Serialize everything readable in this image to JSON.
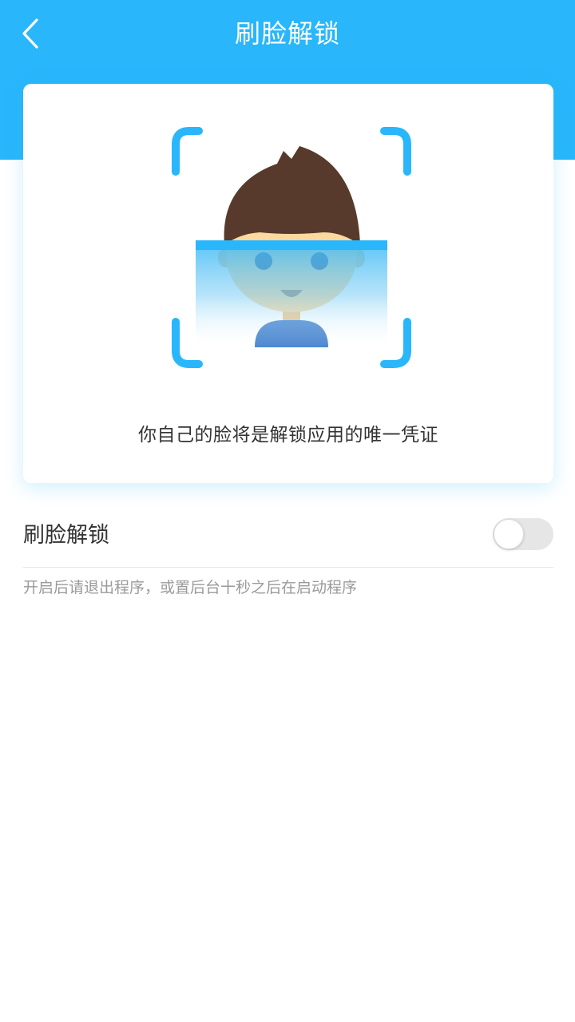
{
  "header": {
    "title": "刷脸解锁",
    "back_icon": "chevron-left-icon",
    "background_color": "#29b6fb"
  },
  "card": {
    "illustration": "face-scan-illustration",
    "caption": "你自己的脸将是解锁应用的唯一凭证"
  },
  "setting": {
    "label": "刷脸解锁",
    "enabled": false,
    "hint": "开启后请退出程序，或置后台十秒之后在启动程序"
  },
  "colors": {
    "accent": "#29b6fb",
    "hair": "#573a2c",
    "skin": "#fdd9a0",
    "shirt": "#4a86cf",
    "text_primary": "#333333",
    "text_secondary": "#9a9a9a",
    "toggle_off": "#e6e6e6"
  }
}
